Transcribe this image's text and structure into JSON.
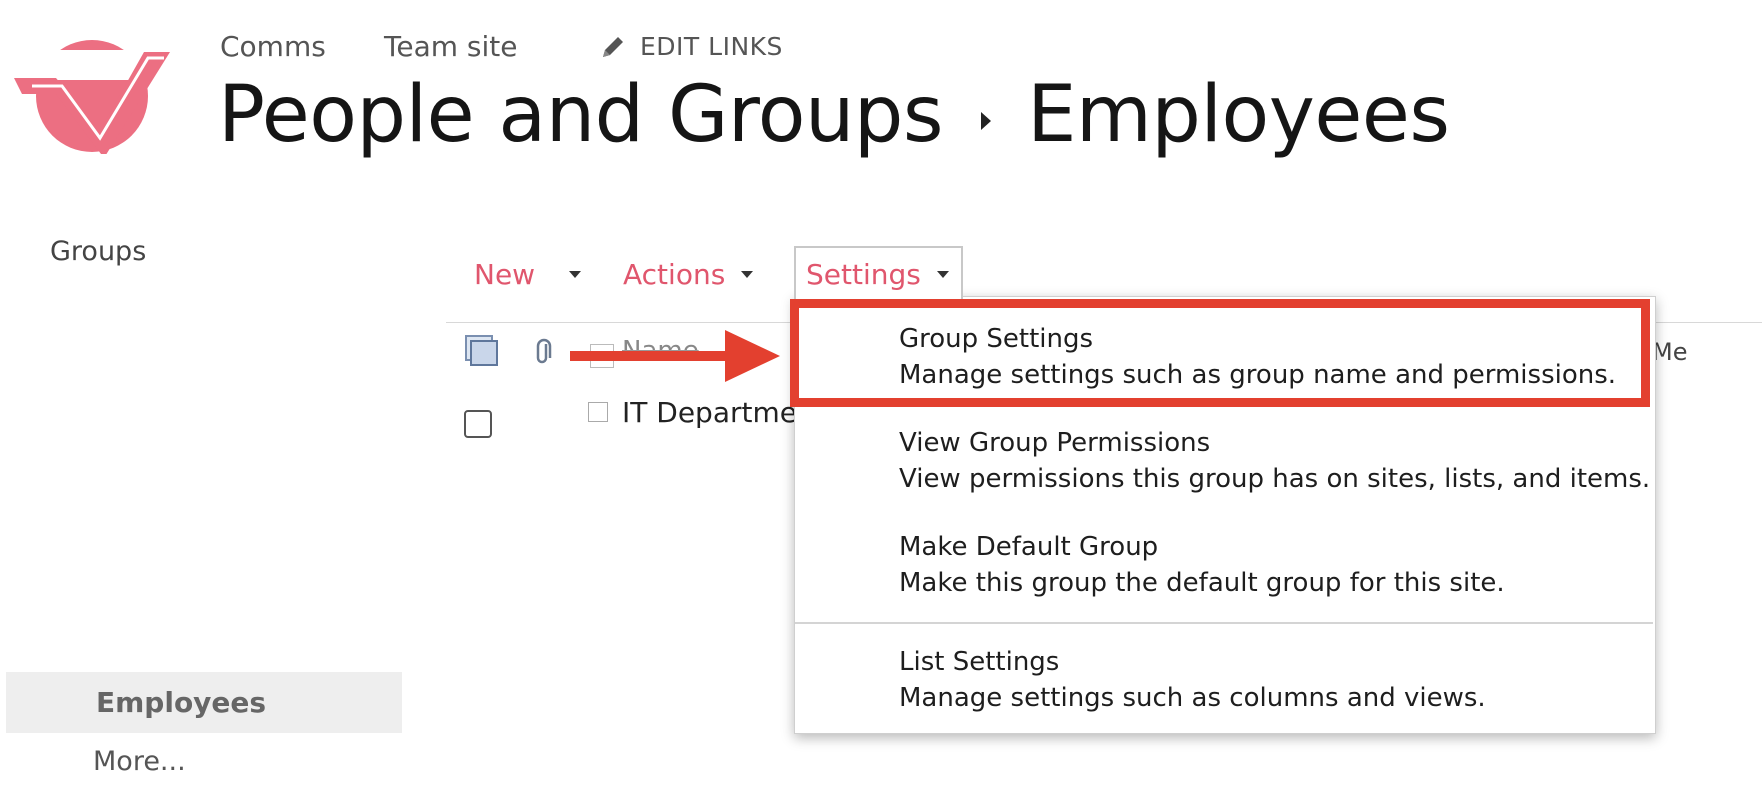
{
  "header": {
    "top_links": [
      "Comms",
      "Team site"
    ],
    "edit_links_label": "EDIT LINKS",
    "breadcrumb": [
      "People and Groups",
      "Employees"
    ]
  },
  "left_nav": {
    "heading": "Groups",
    "selected_item": "Employees",
    "more_label": "More..."
  },
  "toolbar": {
    "new_label": "New",
    "actions_label": "Actions",
    "settings_label": "Settings"
  },
  "list": {
    "columns": [
      "Name",
      "Me"
    ],
    "rows": [
      {
        "name": "IT Departmen"
      }
    ]
  },
  "settings_menu": {
    "items": [
      {
        "title": "Group Settings",
        "description": "Manage settings such as group name and permissions."
      },
      {
        "title": "View Group Permissions",
        "description": "View permissions this group has on sites, lists, and items."
      },
      {
        "title": "Make Default Group",
        "description": "Make this group the default group for this site."
      },
      {
        "title": "List Settings",
        "description": "Manage settings such as columns and views."
      }
    ],
    "highlighted_item": "Group Settings"
  },
  "colors": {
    "accent": "#e0566d",
    "logo": "#ec6f82",
    "callout": "#e3402f",
    "nav_selected_bg": "#eeeeee"
  },
  "icons": [
    "site-logo",
    "pencil-icon",
    "breadcrumb-arrow-icon",
    "list-view-icon",
    "attachment-icon",
    "callout-arrow"
  ]
}
